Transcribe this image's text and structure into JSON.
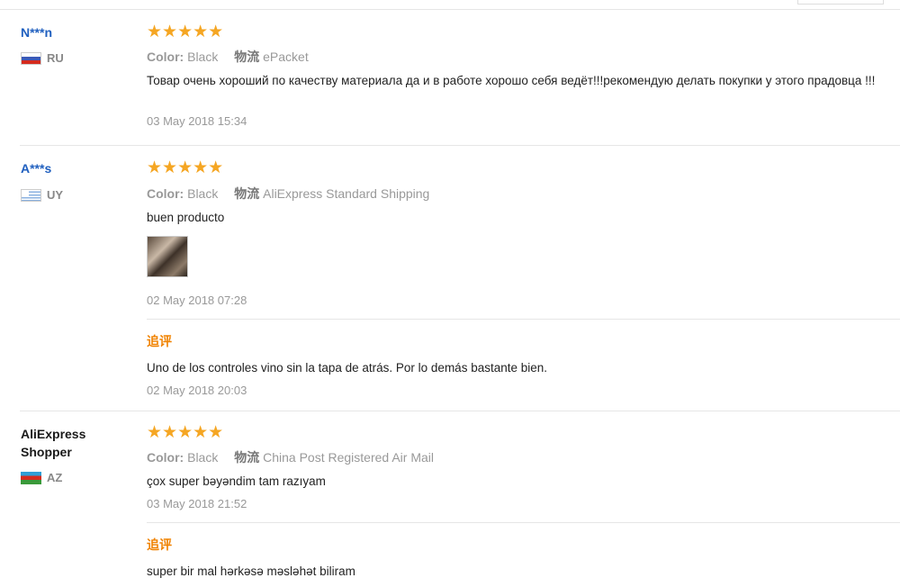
{
  "reviews": [
    {
      "user": "N***n",
      "country": "RU",
      "stars": "★★★★★",
      "color_label": "Color:",
      "color_value": "Black",
      "shipping_label": "物流",
      "shipping_value": "ePacket",
      "text": "Товар очень хороший по качеству материала да и в работе хорошо себя ведёт!!!рекомендую делать покупки у этого прадовца !!!",
      "date": "03 May 2018 15:34"
    },
    {
      "user": "A***s",
      "country": "UY",
      "stars": "★★★★★",
      "color_label": "Color:",
      "color_value": "Black",
      "shipping_label": "物流",
      "shipping_value": "AliExpress Standard Shipping",
      "text": "buen producto",
      "date": "02 May 2018 07:28",
      "followup_label": "追评",
      "followup_text": "Uno de los controles vino sin la tapa de atrás. Por lo demás bastante bien.",
      "followup_date": "02 May 2018 20:03"
    },
    {
      "user_line1": "AliExpress",
      "user_line2": "Shopper",
      "country": "AZ",
      "stars": "★★★★★",
      "color_label": "Color:",
      "color_value": "Black",
      "shipping_label": "物流",
      "shipping_value": "China Post Registered Air Mail",
      "text": "çox super bəyəndim tam razıyam",
      "date": "03 May 2018 21:52",
      "followup_label": "追评",
      "followup_text": "super bir mal hərkəsə məsləhət biliram"
    }
  ]
}
